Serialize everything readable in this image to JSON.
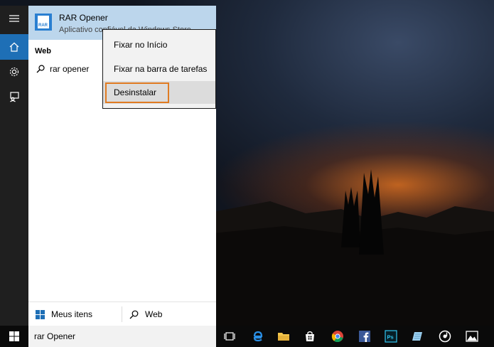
{
  "best_match": {
    "app_name": "RAR Opener",
    "app_subtitle": "Aplicativo confiável da Windows Store",
    "icon": "rar-file-icon"
  },
  "web_section": {
    "header": "Web",
    "suggestion": "rar opener"
  },
  "context_menu": {
    "items": [
      {
        "label": "Fixar no Início"
      },
      {
        "label": "Fixar na barra de tarefas"
      },
      {
        "label": "Desinstalar"
      }
    ],
    "highlighted": "Desinstalar",
    "highlight_color": "#e07b22"
  },
  "bottom_bar": {
    "my_items_label": "Meus itens",
    "web_label": "Web"
  },
  "taskbar": {
    "search_value": "rar Opener",
    "icons": [
      "task-view-icon",
      "edge-icon",
      "file-explorer-icon",
      "store-icon",
      "chrome-icon",
      "facebook-icon",
      "photoshop-icon",
      "notepad-icon",
      "groove-music-icon",
      "photos-icon"
    ]
  },
  "rail": {
    "icons": [
      "hamburger-menu-icon",
      "home-icon",
      "settings-gear-icon",
      "feedback-icon"
    ]
  },
  "colors": {
    "accent": "#1e6fb6",
    "best_match_bg": "#bcd6ec"
  }
}
